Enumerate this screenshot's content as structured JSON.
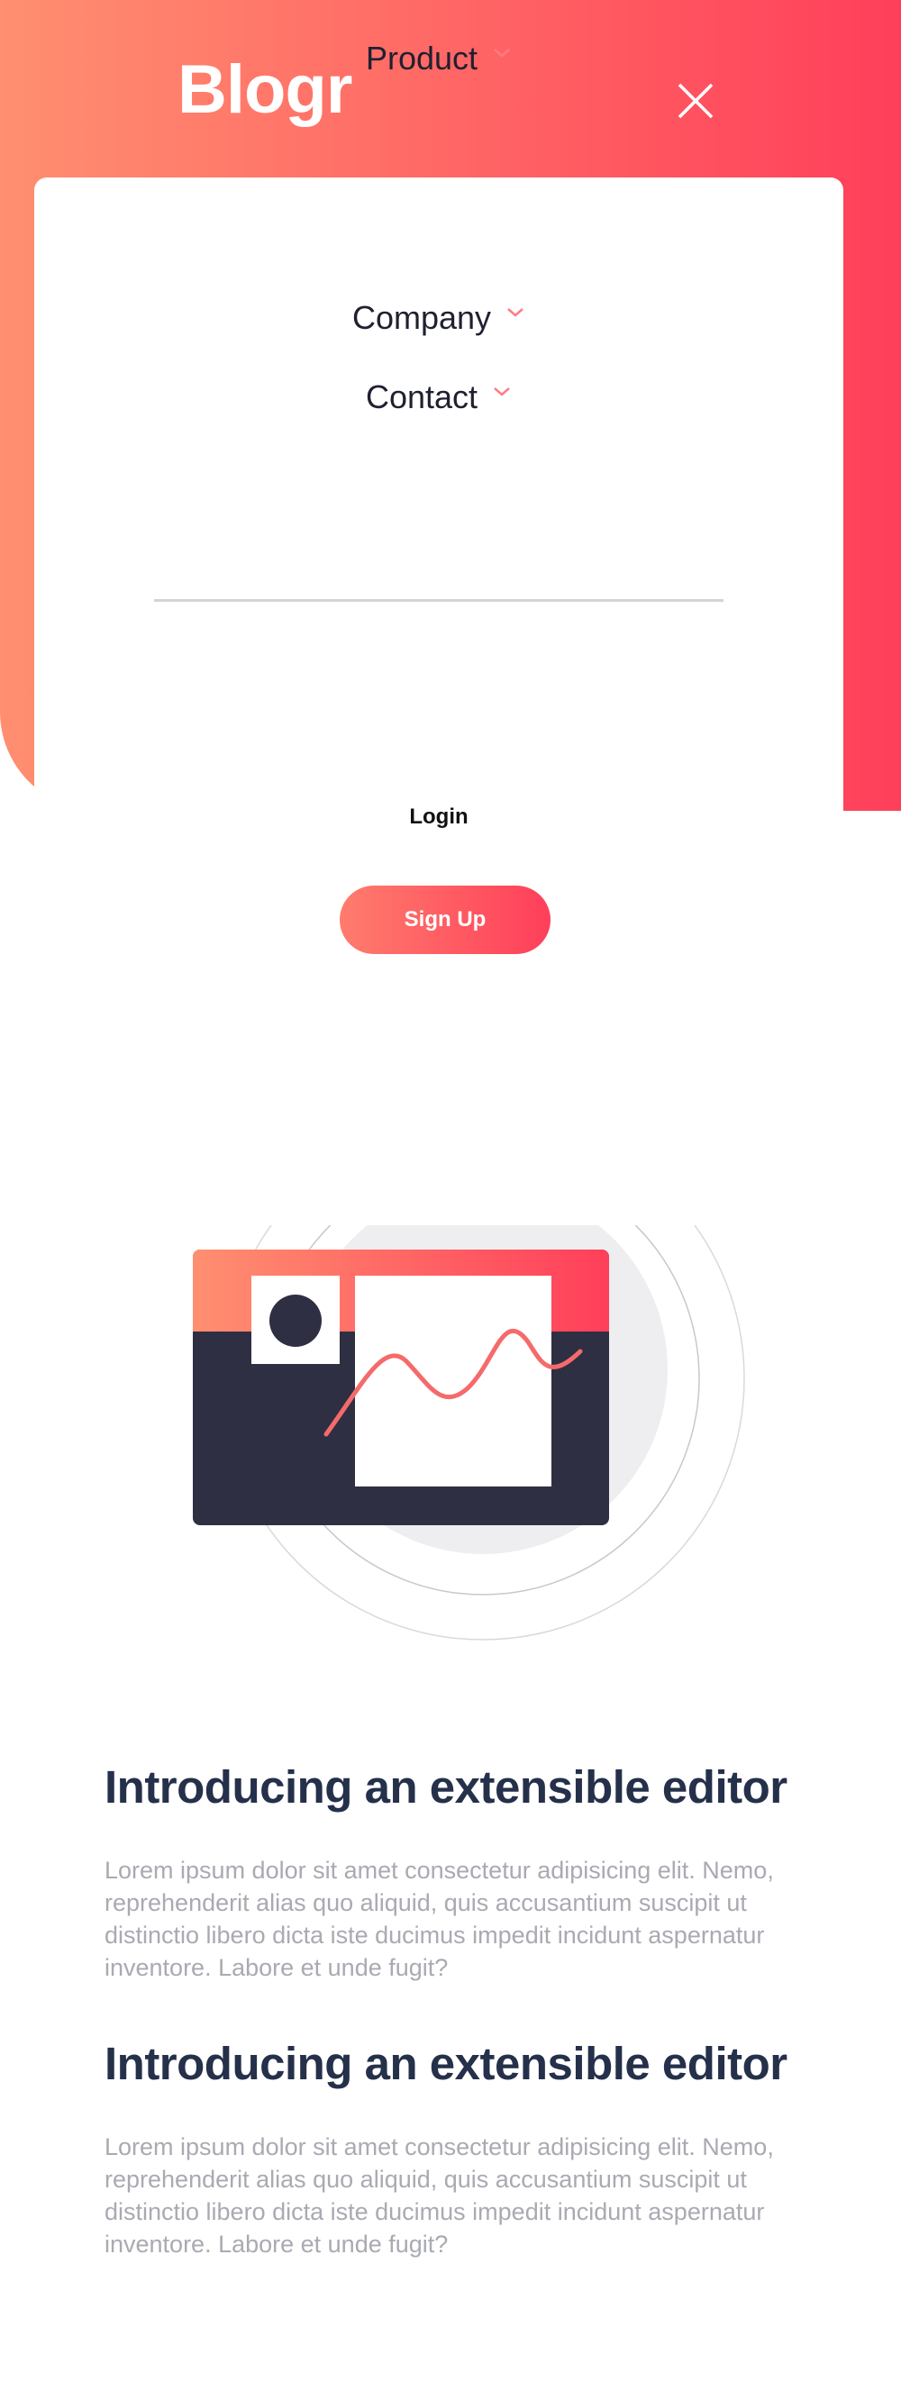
{
  "header": {
    "logo": "Blogr",
    "close_icon": "close-icon"
  },
  "menu": {
    "items": [
      {
        "label": "Product",
        "icon": "chevron-down-icon"
      },
      {
        "label": "Company",
        "icon": "chevron-down-icon"
      },
      {
        "label": "Contact",
        "icon": "chevron-down-icon"
      }
    ],
    "login_label": "Login",
    "signup_label": "Sign Up"
  },
  "colors": {
    "gradient_start": "#ff8f70",
    "gradient_end": "#ff3f5a",
    "heading": "#25304a",
    "body_text": "#a9aab2",
    "chevron": "#ff7b86"
  },
  "sections": [
    {
      "title": "Introducing an extensible editor",
      "body": "Lorem ipsum dolor sit amet consectetur adipisicing elit. Nemo, reprehenderit alias quo aliquid, quis accusantium suscipit ut distinctio libero dicta iste ducimus impedit incidunt aspernatur inventore. Labore et unde fugit?"
    },
    {
      "title": "Introducing an extensible editor",
      "body": "Lorem ipsum dolor sit amet consectetur adipisicing elit. Nemo, reprehenderit alias quo aliquid, quis accusantium suscipit ut distinctio libero dicta iste ducimus impedit incidunt aspernatur inventore. Labore et unde fugit?"
    }
  ]
}
